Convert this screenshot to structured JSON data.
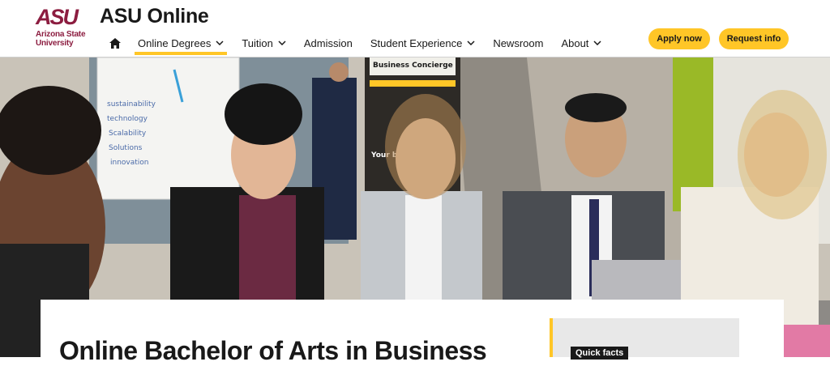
{
  "header": {
    "logo": {
      "mark": "ASU",
      "line1": "Arizona State",
      "line2": "University"
    },
    "site_title": "ASU Online",
    "nav": [
      {
        "label": "Online Degrees",
        "dropdown": true,
        "active": true
      },
      {
        "label": "Tuition",
        "dropdown": true,
        "active": false
      },
      {
        "label": "Admission",
        "dropdown": false,
        "active": false
      },
      {
        "label": "Student Experience",
        "dropdown": true,
        "active": false
      },
      {
        "label": "Newsroom",
        "dropdown": false,
        "active": false
      },
      {
        "label": "About",
        "dropdown": true,
        "active": false
      }
    ],
    "apply_label": "Apply now",
    "request_label": "Request info"
  },
  "hero": {
    "whiteboard_words": [
      "sustainability",
      "technology",
      "Scalability",
      "Solutions",
      "innovation"
    ],
    "banner_text": "Business Concierge",
    "banner_sub": "Your b"
  },
  "main": {
    "title": "Online Bachelor of Arts in Business",
    "quick_facts_label": "Quick facts"
  },
  "colors": {
    "maroon": "#8c1d40",
    "gold": "#ffc627",
    "text": "#191919"
  }
}
